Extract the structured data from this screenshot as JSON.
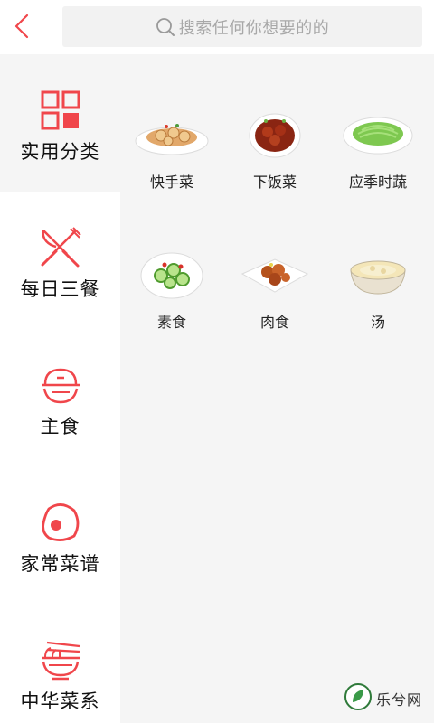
{
  "header": {
    "back_icon": "chevron-left-icon",
    "search": {
      "placeholder": "搜索任何你想要的的",
      "icon": "search-icon"
    }
  },
  "sidebar": {
    "items": [
      {
        "label": "实用分类",
        "icon": "grid-icon",
        "active": true
      },
      {
        "label": "每日三餐",
        "icon": "fork-knife-icon",
        "active": false
      },
      {
        "label": "主食",
        "icon": "rice-bowl-icon",
        "active": false
      },
      {
        "label": "家常菜谱",
        "icon": "egg-icon",
        "active": false
      },
      {
        "label": "中华菜系",
        "icon": "noodle-bowl-icon",
        "active": false
      }
    ]
  },
  "categories": [
    {
      "label": "快手菜",
      "icon": "lotus-root-dish-icon"
    },
    {
      "label": "下饭菜",
      "icon": "braised-pork-dish-icon"
    },
    {
      "label": "应季时蔬",
      "icon": "green-vegetable-dish-icon"
    },
    {
      "label": "素食",
      "icon": "cucumber-dish-icon"
    },
    {
      "label": "肉食",
      "icon": "meat-dish-icon"
    },
    {
      "label": "汤",
      "icon": "soup-bowl-icon"
    }
  ],
  "watermark": {
    "text": "乐兮网",
    "logo": "leaf-logo-icon"
  },
  "colors": {
    "accent": "#f0464b",
    "sidebar_active_bg": "#f5f5f5",
    "content_bg": "#f5f5f5",
    "search_bg": "#f2f2f2"
  }
}
